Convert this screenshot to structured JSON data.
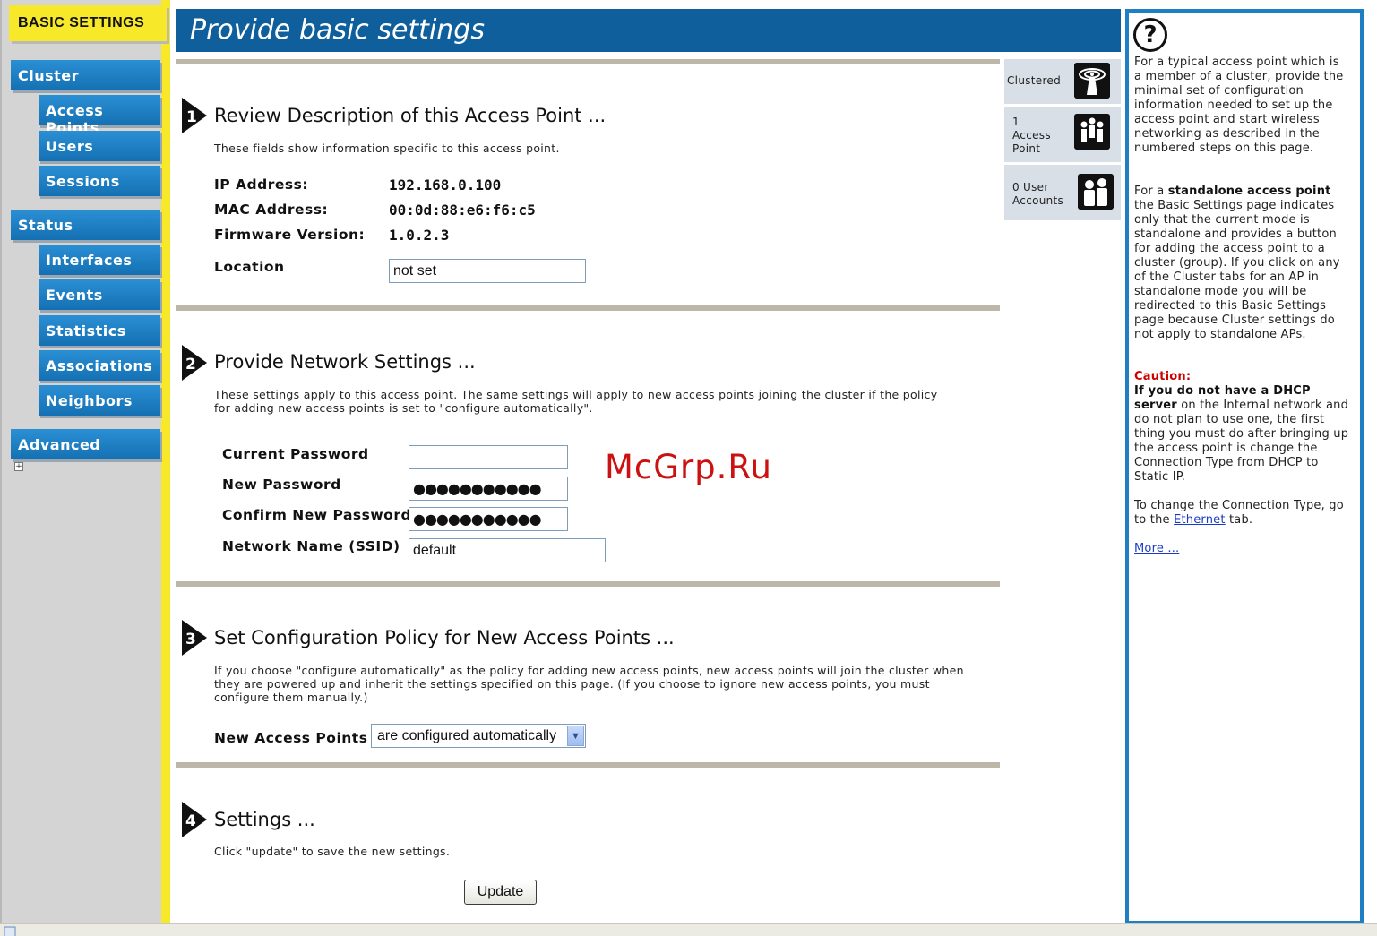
{
  "sidebar": {
    "active_tab": "BASIC SETTINGS",
    "items": [
      {
        "label": "Cluster",
        "level": "main"
      },
      {
        "label": "Access Points",
        "level": "sub"
      },
      {
        "label": "Users",
        "level": "sub"
      },
      {
        "label": "Sessions",
        "level": "sub"
      },
      {
        "label": "Status",
        "level": "main"
      },
      {
        "label": "Interfaces",
        "level": "sub"
      },
      {
        "label": "Events",
        "level": "sub"
      },
      {
        "label": "Statistics",
        "level": "sub"
      },
      {
        "label": "Associations",
        "level": "sub"
      },
      {
        "label": "Neighbors",
        "level": "sub"
      },
      {
        "label": "Advanced",
        "level": "main"
      }
    ],
    "expand_glyph": "+"
  },
  "header": {
    "title": "Provide basic settings"
  },
  "steps": {
    "review": {
      "number": "1",
      "title": "Review Description of this Access Point ...",
      "description": "These fields show information specific to this access point.",
      "ip_label": "IP Address:",
      "ip_value": "192.168.0.100",
      "mac_label": "MAC Address:",
      "mac_value": "00:0d:88:e6:f6:c5",
      "firmware_label": "Firmware Version:",
      "firmware_value": "1.0.2.3",
      "location_label": "Location",
      "location_value": "not set"
    },
    "network": {
      "number": "2",
      "title": "Provide Network Settings ...",
      "description_line1": "These settings apply to this access point. The same settings will apply to new access points joining the cluster if the policy",
      "description_line2": "for adding new access points is set to \"configure automatically\".",
      "current_password_label": "Current Password",
      "current_password_value": "",
      "new_password_label": "New Password",
      "new_password_mask": "●●●●●●●●●●●",
      "confirm_password_label": "Confirm New Password",
      "confirm_password_mask": "●●●●●●●●●●●",
      "ssid_label": "Network Name (SSID)",
      "ssid_value": "default"
    },
    "policy": {
      "number": "3",
      "title": "Set Configuration Policy for New Access Points ...",
      "description_line1": "If you choose \"configure automatically\" as the policy for adding new access points, new access points will join the cluster when",
      "description_line2": "they are powered up and inherit the settings specified on this page. (If you choose to ignore new access points, you must",
      "description_line3": "configure them manually.)",
      "new_ap_label": "New Access Points",
      "new_ap_selected": "are configured automatically"
    },
    "settings": {
      "number": "4",
      "title": "Settings ...",
      "description": "Click \"update\" to save the new settings.",
      "update_label": "Update"
    }
  },
  "status_widgets": {
    "clustered": {
      "label": "Clustered"
    },
    "access_points": {
      "line1": "1",
      "line2": "Access",
      "line3": "Point"
    },
    "user_accounts": {
      "line1": "0 User",
      "line2": "Accounts"
    }
  },
  "watermark": "McGrp.Ru",
  "help": {
    "icon_glyph": "?",
    "p1": "For a typical access point which is a member of a cluster, provide the minimal set of configuration information needed to set up the access point and start wireless networking as described in the numbered steps on this page.",
    "p2_prefix": "For a ",
    "p2_bold": "standalone access point",
    "p2_suffix": " the Basic Settings page indicates only that the current mode is standalone and provides a button for adding the access point to a cluster (group). If you click on any of the Cluster tabs for an AP in standalone mode you will be redirected to this Basic Settings page because Cluster settings do not apply to standalone APs.",
    "caution_label": "Caution:",
    "caution_bold": "If you do not have a DHCP server",
    "caution_text": " on the Internal network and do not plan to use one, the first thing you must do after bringing up the access point is change the Connection Type from DHCP to Static IP.",
    "p4_prefix": "To change the Connection Type, go to the ",
    "p4_link": "Ethernet",
    "p4_suffix": " tab.",
    "more_link": "More ..."
  },
  "colors": {
    "nav_blue": "#1f7fc4",
    "header_blue": "#0f5f9c",
    "accent_yellow": "#f7e92a",
    "caution_red": "#cc0000",
    "watermark_red": "#cc1111"
  }
}
